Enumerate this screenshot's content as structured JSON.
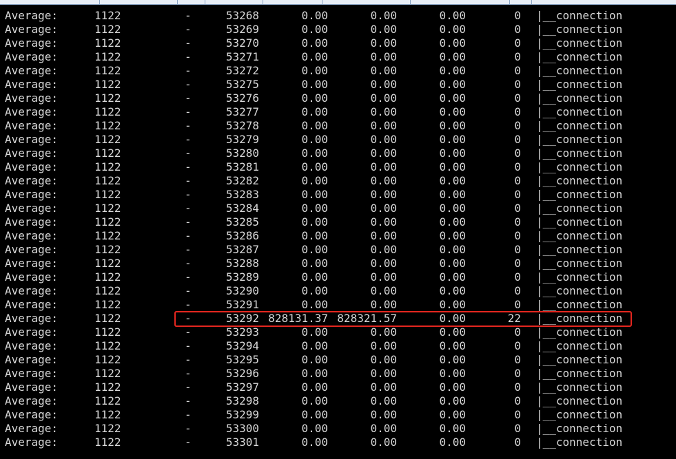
{
  "terminal": {
    "rows": [
      {
        "label": "Average:",
        "uid": "1122",
        "tgid": "-",
        "tid": "53268",
        "kb_rd": "0.00",
        "kb_wr": "0.00",
        "kb_ccwr": "0.00",
        "iodelay": "0",
        "command": "|__connection"
      },
      {
        "label": "Average:",
        "uid": "1122",
        "tgid": "-",
        "tid": "53269",
        "kb_rd": "0.00",
        "kb_wr": "0.00",
        "kb_ccwr": "0.00",
        "iodelay": "0",
        "command": "|__connection"
      },
      {
        "label": "Average:",
        "uid": "1122",
        "tgid": "-",
        "tid": "53270",
        "kb_rd": "0.00",
        "kb_wr": "0.00",
        "kb_ccwr": "0.00",
        "iodelay": "0",
        "command": "|__connection"
      },
      {
        "label": "Average:",
        "uid": "1122",
        "tgid": "-",
        "tid": "53271",
        "kb_rd": "0.00",
        "kb_wr": "0.00",
        "kb_ccwr": "0.00",
        "iodelay": "0",
        "command": "|__connection"
      },
      {
        "label": "Average:",
        "uid": "1122",
        "tgid": "-",
        "tid": "53272",
        "kb_rd": "0.00",
        "kb_wr": "0.00",
        "kb_ccwr": "0.00",
        "iodelay": "0",
        "command": "|__connection"
      },
      {
        "label": "Average:",
        "uid": "1122",
        "tgid": "-",
        "tid": "53275",
        "kb_rd": "0.00",
        "kb_wr": "0.00",
        "kb_ccwr": "0.00",
        "iodelay": "0",
        "command": "|__connection"
      },
      {
        "label": "Average:",
        "uid": "1122",
        "tgid": "-",
        "tid": "53276",
        "kb_rd": "0.00",
        "kb_wr": "0.00",
        "kb_ccwr": "0.00",
        "iodelay": "0",
        "command": "|__connection"
      },
      {
        "label": "Average:",
        "uid": "1122",
        "tgid": "-",
        "tid": "53277",
        "kb_rd": "0.00",
        "kb_wr": "0.00",
        "kb_ccwr": "0.00",
        "iodelay": "0",
        "command": "|__connection"
      },
      {
        "label": "Average:",
        "uid": "1122",
        "tgid": "-",
        "tid": "53278",
        "kb_rd": "0.00",
        "kb_wr": "0.00",
        "kb_ccwr": "0.00",
        "iodelay": "0",
        "command": "|__connection"
      },
      {
        "label": "Average:",
        "uid": "1122",
        "tgid": "-",
        "tid": "53279",
        "kb_rd": "0.00",
        "kb_wr": "0.00",
        "kb_ccwr": "0.00",
        "iodelay": "0",
        "command": "|__connection"
      },
      {
        "label": "Average:",
        "uid": "1122",
        "tgid": "-",
        "tid": "53280",
        "kb_rd": "0.00",
        "kb_wr": "0.00",
        "kb_ccwr": "0.00",
        "iodelay": "0",
        "command": "|__connection"
      },
      {
        "label": "Average:",
        "uid": "1122",
        "tgid": "-",
        "tid": "53281",
        "kb_rd": "0.00",
        "kb_wr": "0.00",
        "kb_ccwr": "0.00",
        "iodelay": "0",
        "command": "|__connection"
      },
      {
        "label": "Average:",
        "uid": "1122",
        "tgid": "-",
        "tid": "53282",
        "kb_rd": "0.00",
        "kb_wr": "0.00",
        "kb_ccwr": "0.00",
        "iodelay": "0",
        "command": "|__connection"
      },
      {
        "label": "Average:",
        "uid": "1122",
        "tgid": "-",
        "tid": "53283",
        "kb_rd": "0.00",
        "kb_wr": "0.00",
        "kb_ccwr": "0.00",
        "iodelay": "0",
        "command": "|__connection"
      },
      {
        "label": "Average:",
        "uid": "1122",
        "tgid": "-",
        "tid": "53284",
        "kb_rd": "0.00",
        "kb_wr": "0.00",
        "kb_ccwr": "0.00",
        "iodelay": "0",
        "command": "|__connection"
      },
      {
        "label": "Average:",
        "uid": "1122",
        "tgid": "-",
        "tid": "53285",
        "kb_rd": "0.00",
        "kb_wr": "0.00",
        "kb_ccwr": "0.00",
        "iodelay": "0",
        "command": "|__connection"
      },
      {
        "label": "Average:",
        "uid": "1122",
        "tgid": "-",
        "tid": "53286",
        "kb_rd": "0.00",
        "kb_wr": "0.00",
        "kb_ccwr": "0.00",
        "iodelay": "0",
        "command": "|__connection"
      },
      {
        "label": "Average:",
        "uid": "1122",
        "tgid": "-",
        "tid": "53287",
        "kb_rd": "0.00",
        "kb_wr": "0.00",
        "kb_ccwr": "0.00",
        "iodelay": "0",
        "command": "|__connection"
      },
      {
        "label": "Average:",
        "uid": "1122",
        "tgid": "-",
        "tid": "53288",
        "kb_rd": "0.00",
        "kb_wr": "0.00",
        "kb_ccwr": "0.00",
        "iodelay": "0",
        "command": "|__connection"
      },
      {
        "label": "Average:",
        "uid": "1122",
        "tgid": "-",
        "tid": "53289",
        "kb_rd": "0.00",
        "kb_wr": "0.00",
        "kb_ccwr": "0.00",
        "iodelay": "0",
        "command": "|__connection"
      },
      {
        "label": "Average:",
        "uid": "1122",
        "tgid": "-",
        "tid": "53290",
        "kb_rd": "0.00",
        "kb_wr": "0.00",
        "kb_ccwr": "0.00",
        "iodelay": "0",
        "command": "|__connection"
      },
      {
        "label": "Average:",
        "uid": "1122",
        "tgid": "-",
        "tid": "53291",
        "kb_rd": "0.00",
        "kb_wr": "0.00",
        "kb_ccwr": "0.00",
        "iodelay": "0",
        "command": "|__connection"
      },
      {
        "label": "Average:",
        "uid": "1122",
        "tgid": "-",
        "tid": "53292",
        "kb_rd": "828131.37",
        "kb_wr": "828321.57",
        "kb_ccwr": "0.00",
        "iodelay": "22",
        "command": "|__connection"
      },
      {
        "label": "Average:",
        "uid": "1122",
        "tgid": "-",
        "tid": "53293",
        "kb_rd": "0.00",
        "kb_wr": "0.00",
        "kb_ccwr": "0.00",
        "iodelay": "0",
        "command": "|__connection"
      },
      {
        "label": "Average:",
        "uid": "1122",
        "tgid": "-",
        "tid": "53294",
        "kb_rd": "0.00",
        "kb_wr": "0.00",
        "kb_ccwr": "0.00",
        "iodelay": "0",
        "command": "|__connection"
      },
      {
        "label": "Average:",
        "uid": "1122",
        "tgid": "-",
        "tid": "53295",
        "kb_rd": "0.00",
        "kb_wr": "0.00",
        "kb_ccwr": "0.00",
        "iodelay": "0",
        "command": "|__connection"
      },
      {
        "label": "Average:",
        "uid": "1122",
        "tgid": "-",
        "tid": "53296",
        "kb_rd": "0.00",
        "kb_wr": "0.00",
        "kb_ccwr": "0.00",
        "iodelay": "0",
        "command": "|__connection"
      },
      {
        "label": "Average:",
        "uid": "1122",
        "tgid": "-",
        "tid": "53297",
        "kb_rd": "0.00",
        "kb_wr": "0.00",
        "kb_ccwr": "0.00",
        "iodelay": "0",
        "command": "|__connection"
      },
      {
        "label": "Average:",
        "uid": "1122",
        "tgid": "-",
        "tid": "53298",
        "kb_rd": "0.00",
        "kb_wr": "0.00",
        "kb_ccwr": "0.00",
        "iodelay": "0",
        "command": "|__connection"
      },
      {
        "label": "Average:",
        "uid": "1122",
        "tgid": "-",
        "tid": "53299",
        "kb_rd": "0.00",
        "kb_wr": "0.00",
        "kb_ccwr": "0.00",
        "iodelay": "0",
        "command": "|__connection"
      },
      {
        "label": "Average:",
        "uid": "1122",
        "tgid": "-",
        "tid": "53300",
        "kb_rd": "0.00",
        "kb_wr": "0.00",
        "kb_ccwr": "0.00",
        "iodelay": "0",
        "command": "|__connection"
      },
      {
        "label": "Average:",
        "uid": "1122",
        "tgid": "-",
        "tid": "53301",
        "kb_rd": "0.00",
        "kb_wr": "0.00",
        "kb_ccwr": "0.00",
        "iodelay": "0",
        "command": "|__connection"
      }
    ],
    "highlighted_tid": "53292",
    "colors": {
      "background": "#000000",
      "text": "#d8d8d8",
      "highlight_border": "#e5261f"
    }
  }
}
